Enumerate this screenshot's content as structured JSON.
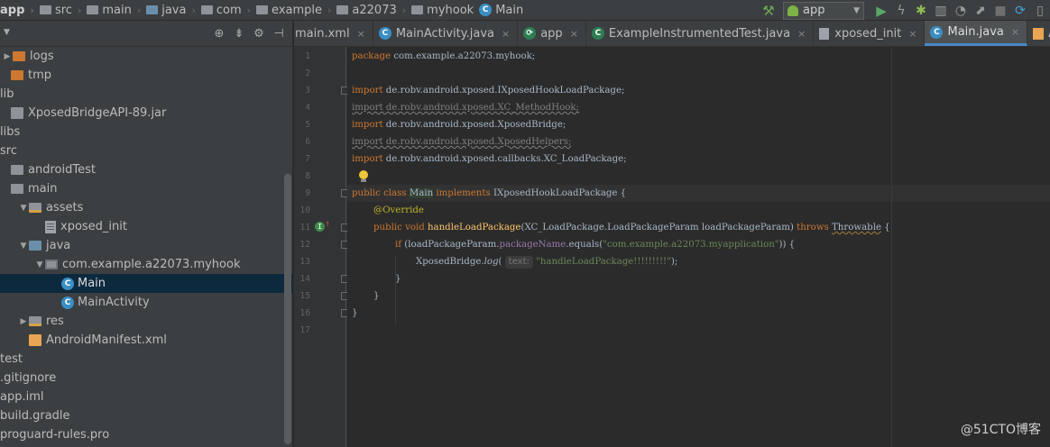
{
  "navbar": {
    "crumbs": [
      {
        "label": "app",
        "icon": "folder-icon"
      },
      {
        "label": "src",
        "icon": "folder-icon"
      },
      {
        "label": "main",
        "icon": "folder-icon"
      },
      {
        "label": "java",
        "icon": "source-folder-icon"
      },
      {
        "label": "com",
        "icon": "package-icon"
      },
      {
        "label": "example",
        "icon": "package-icon"
      },
      {
        "label": "a22073",
        "icon": "package-icon"
      },
      {
        "label": "myhook",
        "icon": "package-icon"
      },
      {
        "label": "Main",
        "icon": "class-icon"
      }
    ],
    "run_config": "app",
    "class_icon_letter": "C"
  },
  "project": {
    "items": [
      {
        "label": "logs",
        "arrow": "▶",
        "icon": "folder-orange",
        "indent": 0
      },
      {
        "label": "tmp",
        "arrow": "",
        "icon": "folder-orange",
        "indent": 0
      },
      {
        "label": "lib",
        "arrow": "",
        "icon": "none",
        "indent": 0
      },
      {
        "label": "XposedBridgeAPI-89.jar",
        "arrow": "",
        "icon": "jar",
        "indent": 0
      },
      {
        "label": "libs",
        "arrow": "",
        "icon": "none",
        "indent": 0
      },
      {
        "label": "src",
        "arrow": "",
        "icon": "none",
        "indent": 0
      },
      {
        "label": "androidTest",
        "arrow": "",
        "icon": "folder",
        "indent": 0
      },
      {
        "label": "main",
        "arrow": "",
        "icon": "folder",
        "indent": 0
      },
      {
        "label": "assets",
        "arrow": "▼",
        "icon": "folder-res",
        "indent": 1
      },
      {
        "label": "xposed_init",
        "arrow": "",
        "icon": "file",
        "indent": 2
      },
      {
        "label": "java",
        "arrow": "▼",
        "icon": "folder-blue",
        "indent": 1
      },
      {
        "label": "com.example.a22073.myhook",
        "arrow": "▼",
        "icon": "package",
        "indent": 2
      },
      {
        "label": "Main",
        "arrow": "",
        "icon": "class",
        "indent": 3,
        "selected": true
      },
      {
        "label": "MainActivity",
        "arrow": "",
        "icon": "class",
        "indent": 3
      },
      {
        "label": "res",
        "arrow": "▶",
        "icon": "folder-res",
        "indent": 1
      },
      {
        "label": "AndroidManifest.xml",
        "arrow": "",
        "icon": "xml",
        "indent": 1
      },
      {
        "label": "test",
        "arrow": "",
        "icon": "none",
        "indent": 0
      },
      {
        "label": ".gitignore",
        "arrow": "",
        "icon": "none",
        "indent": 0
      },
      {
        "label": "app.iml",
        "arrow": "",
        "icon": "none",
        "indent": 0
      },
      {
        "label": "build.gradle",
        "arrow": "",
        "icon": "none",
        "indent": 0
      },
      {
        "label": "proguard-rules.pro",
        "arrow": "",
        "icon": "none",
        "indent": 0
      }
    ]
  },
  "tabs": [
    {
      "label": "main.xml",
      "icon": "none",
      "close": "×"
    },
    {
      "label": "MainActivity.java",
      "icon": "class",
      "close": "×"
    },
    {
      "label": "app",
      "icon": "gradle",
      "close": "×"
    },
    {
      "label": "ExampleInstrumentedTest.java",
      "icon": "class-green",
      "close": "×"
    },
    {
      "label": "xposed_init",
      "icon": "file",
      "close": "×"
    },
    {
      "label": "Main.java",
      "icon": "class",
      "close": "×",
      "active": true
    },
    {
      "label": "AndroidMani",
      "icon": "xml",
      "close": ""
    }
  ],
  "editor": {
    "line_numbers": [
      "1",
      "2",
      "3",
      "4",
      "5",
      "6",
      "7",
      "8",
      "9",
      "10",
      "11",
      "12",
      "13",
      "14",
      "15",
      "16",
      "17"
    ],
    "code": {
      "l1_kw": "package",
      "l1_rest": " com.example.a22073.myhook;",
      "l3_kw": "import",
      "l3_rest": " de.robv.android.xposed.IXposedHookLoadPackage;",
      "l4": "import de.robv.android.xposed.XC_MethodHook;",
      "l5_kw": "import",
      "l5_rest": " de.robv.android.xposed.XposedBridge;",
      "l6": "import de.robv.android.xposed.XposedHelpers;",
      "l7_kw": "import",
      "l7_rest": " de.robv.android.xposed.callbacks.XC_LoadPackage;",
      "l9_kw1": "public class",
      "l9_cls": "Main",
      "l9_kw2": "implements",
      "l9_rest": " IXposedHookLoadPackage {",
      "l10_ann": "@Override",
      "l11_kw": "public void",
      "l11_fn": "handleLoadPackage",
      "l11_params": "(XC_LoadPackage.LoadPackageParam loadPackageParam)",
      "l11_throws": "throws",
      "l11_exc": "Throwable",
      "l11_end": " {",
      "l12_kw": "if",
      "l12_a": " (loadPackageParam.",
      "l12_fld": "packageName",
      "l12_b": ".equals(",
      "l12_str": "\"com.example.a22073.myapplication\"",
      "l12_c": ")) {",
      "l13_a": "XposedBridge.",
      "l13_log": "log",
      "l13_b": "(",
      "l13_hint": "text:",
      "l13_str": "\"handleLoadPackage!!!!!!!!!\"",
      "l13_c": ");",
      "l14": "}",
      "l15": "}",
      "l16": "}"
    }
  },
  "watermark": "@51CTO博客",
  "colors": {
    "background": "#2b2b2b",
    "keyword": "#cc7832",
    "method": "#ffc66d",
    "string": "#6a8759",
    "annotation": "#bbb529",
    "field": "#9876aa",
    "selection": "#0d293e",
    "accent": "#4a88c7"
  }
}
